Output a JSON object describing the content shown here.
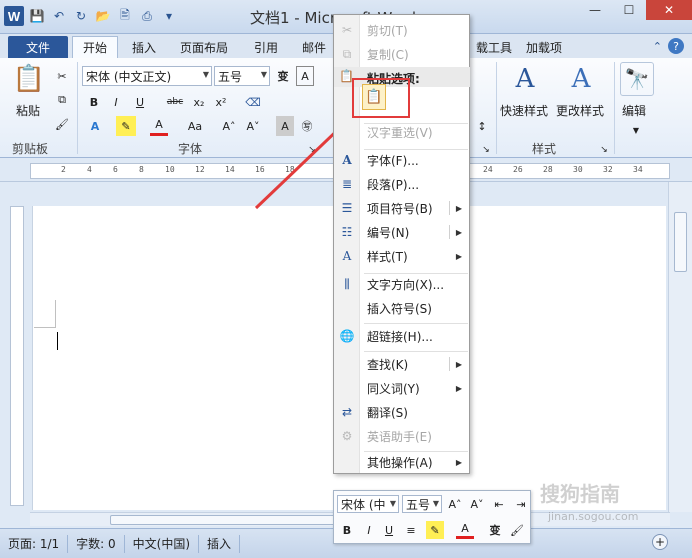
{
  "window": {
    "title": "文档1 - Microsoft Word",
    "minimize": "—",
    "maximize": "☐",
    "close": "✕"
  },
  "qat": {
    "app_icon": "W"
  },
  "tabs": [
    {
      "label": "文件"
    },
    {
      "label": "开始"
    },
    {
      "label": "插入"
    },
    {
      "label": "页面布局"
    },
    {
      "label": "引用"
    },
    {
      "label": "邮件"
    },
    {
      "label": "加载项"
    }
  ],
  "tab_partial": "载工具",
  "ribbon": {
    "clipboard": {
      "paste": "粘贴",
      "group": "剪贴板"
    },
    "font": {
      "family": "宋体 (中文正文)",
      "size": "五号",
      "group": "字体",
      "wen": "变",
      "bold": "B",
      "italic": "I",
      "underline": "U",
      "strike": "abc",
      "sub": "x₂",
      "sup": "x²",
      "fontcolor": "A",
      "aa": "Aa",
      "grow": "A˄",
      "shrink": "A˅",
      "chara": "A"
    },
    "styles": {
      "quick": "快速样式",
      "change": "更改样式",
      "group": "样式"
    },
    "editing": {
      "label": "编辑"
    }
  },
  "ruler_numbers": [
    "2",
    "4",
    "6",
    "8",
    "10",
    "12",
    "14",
    "16",
    "18",
    "20",
    "22",
    "24",
    "26",
    "28",
    "30",
    "32",
    "34"
  ],
  "context_menu": {
    "cut": "剪切(T)",
    "copy": "复制(C)",
    "paste_options": "粘贴选项:",
    "reconvert": "汉字重选(V)",
    "font": "字体(F)...",
    "paragraph": "段落(P)...",
    "bullets": "项目符号(B)",
    "numbering": "编号(N)",
    "styles": "样式(T)",
    "text_direction": "文字方向(X)...",
    "insert_symbol": "插入符号(S)",
    "hyperlink": "超链接(H)...",
    "lookup": "查找(K)",
    "synonyms": "同义词(Y)",
    "translate": "翻译(S)",
    "english_assistant": "英语助手(E)",
    "more": "其他操作(A)"
  },
  "mini_toolbar": {
    "font": "宋体 (中",
    "size": "五号",
    "wen": "变"
  },
  "status": {
    "page": "页面: 1/1",
    "words": "字数: 0",
    "language": "中文(中国)",
    "mode": "插入"
  },
  "watermark": {
    "brand": "搜狗指南",
    "url": "jinan.sogou.com"
  },
  "colors": {
    "file_tab": "#2b579a",
    "highlight": "#e23b3b",
    "close": "#c9453b"
  }
}
